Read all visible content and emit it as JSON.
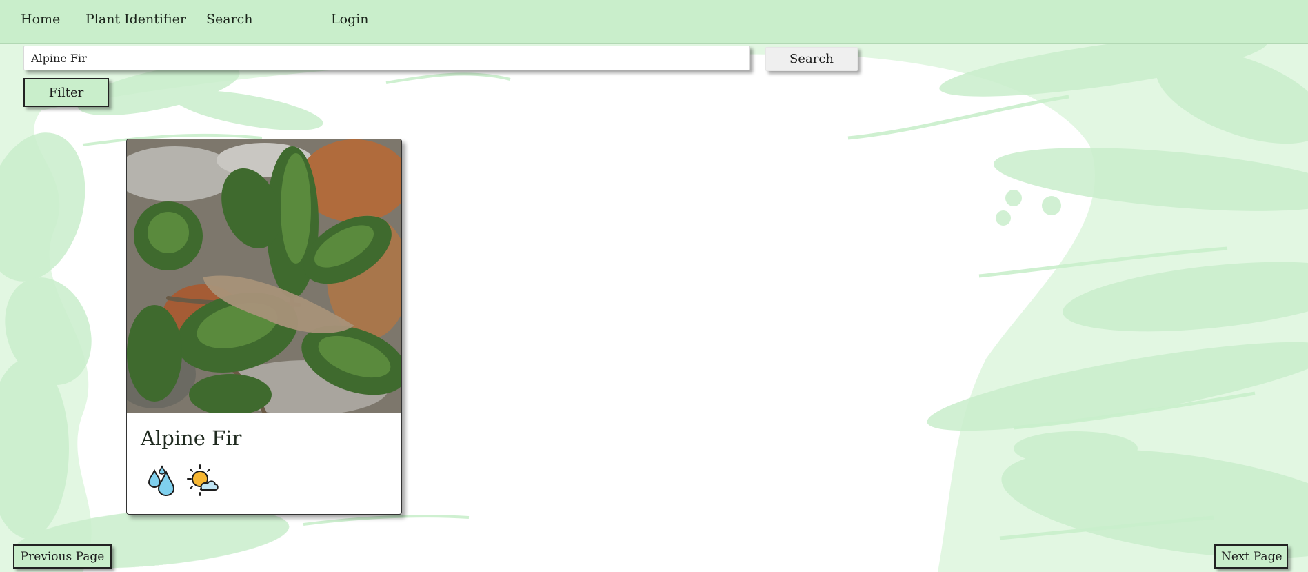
{
  "colors": {
    "background": "#e2f7e2",
    "navbar": "#c9eecb",
    "leaf_dark": "#c9eecb",
    "leaf_light": "#ffffff",
    "button_green": "#c9eecb"
  },
  "navbar": {
    "items": [
      {
        "label": "Home"
      },
      {
        "label": "Plant Identifier"
      },
      {
        "label": "Search"
      },
      {
        "label": "Login"
      }
    ]
  },
  "search": {
    "value": "Alpine Fir",
    "button_label": "Search"
  },
  "filter": {
    "label": "Filter"
  },
  "results": [
    {
      "name": "Alpine Fir",
      "image": "photo of alpine fir branches",
      "care_icons": [
        "water-drops-icon",
        "partly-sunny-icon"
      ]
    }
  ],
  "pagination": {
    "previous_label": "Previous Page",
    "next_label": "Next Page"
  }
}
